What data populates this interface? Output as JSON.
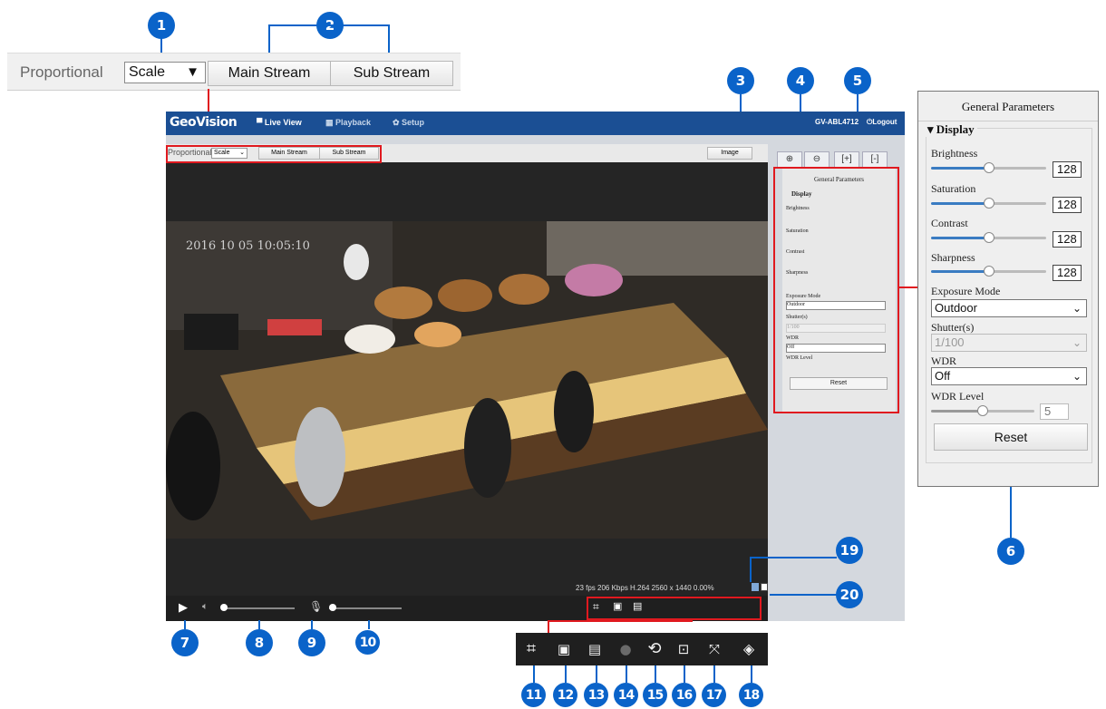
{
  "zoom_top": {
    "proportional_label": "Proportional",
    "scale_value": "Scale",
    "main_stream": "Main Stream",
    "sub_stream": "Sub Stream"
  },
  "nav": {
    "logo": "GeoVision",
    "live_view": "Live View",
    "playback": "Playback",
    "setup": "Setup",
    "device": "GV-ABL4712",
    "logout": "Logout"
  },
  "subbar": {
    "proportional_label": "Proportional",
    "scale_value": "Scale",
    "main_stream": "Main Stream",
    "sub_stream": "Sub Stream",
    "image_button": "Image"
  },
  "video": {
    "timestamp": "2016 10 05 10:05:10",
    "stats": "23 fps   206 Kbps  H.264   2560 x 1440  0.00%"
  },
  "params": {
    "title": "General Parameters",
    "display_legend": "Display",
    "brightness_label": "Brightness",
    "brightness_value": "128",
    "brightness_level": 0.5,
    "saturation_label": "Saturation",
    "saturation_value": "128",
    "saturation_level": 0.5,
    "contrast_label": "Contrast",
    "contrast_value": "128",
    "contrast_level": 0.5,
    "sharpness_label": "Sharpness",
    "sharpness_value": "128",
    "sharpness_level": 0.5,
    "exposure_label": "Exposure Mode",
    "exposure_value": "Outdoor",
    "shutter_label": "Shutter(s)",
    "shutter_value": "1/100",
    "wdr_label": "WDR",
    "wdr_value": "Off",
    "wdr_level_label": "WDR Level",
    "wdr_level_value": "5",
    "wdr_level_level": 0.5,
    "reset_label": "Reset"
  },
  "badges": [
    "1",
    "2",
    "3",
    "4",
    "5",
    "6",
    "7",
    "8",
    "9",
    "10",
    "11",
    "12",
    "13",
    "14",
    "15",
    "16",
    "17",
    "18",
    "19",
    "20"
  ],
  "colors": {
    "badge": "#0a63c9",
    "highlight": "#e0191f",
    "nav": "#1b4f94"
  }
}
